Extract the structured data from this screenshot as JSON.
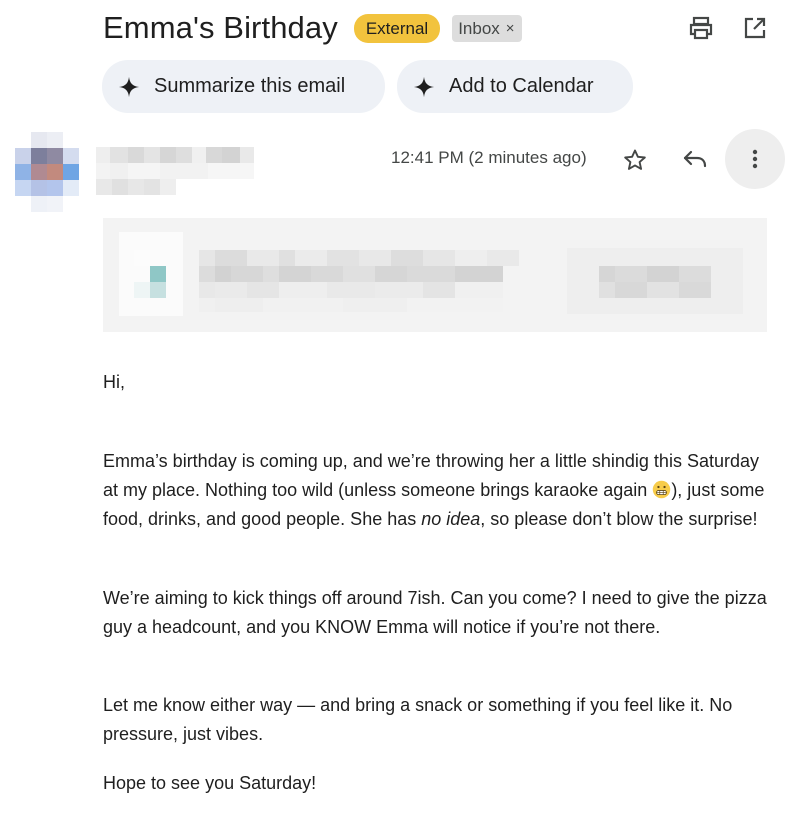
{
  "email": {
    "subject": "Emma's Birthday",
    "labels": {
      "external": "External",
      "inbox": "Inbox",
      "remove_symbol": "×"
    },
    "timestamp": "12:41 PM (2 minutes ago)"
  },
  "actions": {
    "summarize_label": "Summarize this email",
    "calendar_label": "Add to Calendar"
  },
  "icons": {
    "print": "print-icon",
    "open_new_window": "open-in-new-window-icon",
    "sparkle": "sparkle-icon",
    "star": "star-icon",
    "reply": "reply-icon",
    "more": "more-vertical-icon",
    "emoji": "grimacing-face-emoji"
  },
  "body": {
    "greeting": "Hi,",
    "p1_before_emoji": "Emma’s birthday is coming up, and we’re throwing her a little shindig this Saturday at my place. Nothing too wild (unless someone brings karaoke again ",
    "p1_after_emoji": "), just some food, drinks, and good people. She has ",
    "p1_emphasis": "no idea",
    "p1_end": ", so please don’t blow the surprise!",
    "p2": "We’re aiming to kick things off around 7ish. Can you come? I need to give the pizza guy a headcount, and you KNOW Emma will notice if you’re not there.",
    "p3": "Let me know either way — and bring a snack or something if you feel like it. No pressure, just vibes.",
    "p4": "Hope to see you Saturday!"
  },
  "colors": {
    "external_badge": "#f2c33d",
    "inbox_badge": "#dddddd",
    "chip_bg": "#eef1f6",
    "text": "#1f1f1f",
    "secondary_text": "#444746"
  }
}
